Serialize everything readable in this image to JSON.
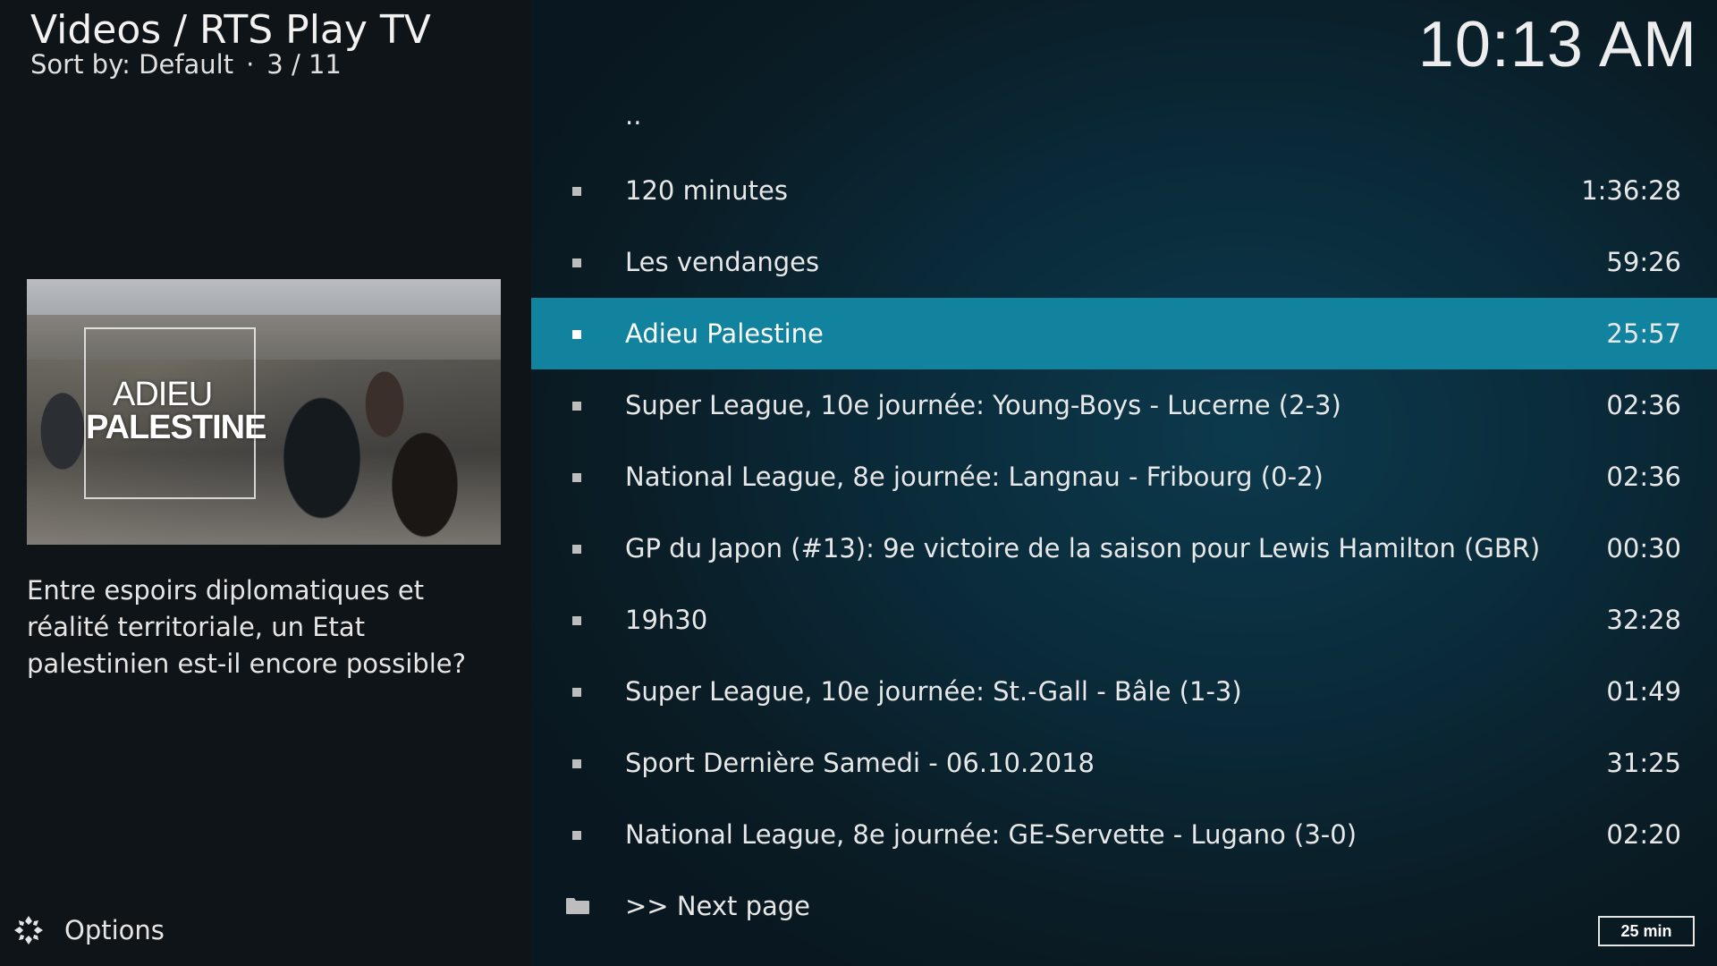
{
  "header": {
    "title": "Videos / RTS Play TV",
    "sort_label": "Sort by: Default",
    "separator": "·",
    "position": "3 / 11"
  },
  "clock": "10:13 AM",
  "selected_item": {
    "thumbnail_text_line1": "ADIEU",
    "thumbnail_text_line2": "PALESTINE",
    "plot": "Entre espoirs diplomatiques et réalité territoriale, un Etat palestinien est-il encore possible?"
  },
  "options": {
    "label": "Options",
    "icon": "options-gear-icon"
  },
  "list": {
    "parent": "..",
    "items": [
      {
        "title": "120 minutes",
        "duration": "1:36:28",
        "selected": false
      },
      {
        "title": "Les vendanges",
        "duration": "59:26",
        "selected": false
      },
      {
        "title": "Adieu Palestine",
        "duration": "25:57",
        "selected": true
      },
      {
        "title": "Super League, 10e journée: Young-Boys - Lucerne (2-3)",
        "duration": "02:36",
        "selected": false
      },
      {
        "title": "National League, 8e journée: Langnau - Fribourg (0-2)",
        "duration": "02:36",
        "selected": false
      },
      {
        "title": "GP du Japon (#13): 9e victoire de la saison pour Lewis Hamilton (GBR)",
        "duration": "00:30",
        "selected": false
      },
      {
        "title": "19h30",
        "duration": "32:28",
        "selected": false
      },
      {
        "title": "Super League, 10e journée: St.-Gall - Bâle (1-3)",
        "duration": "01:49",
        "selected": false
      },
      {
        "title": "Sport Dernière Samedi - 06.10.2018",
        "duration": "31:25",
        "selected": false
      },
      {
        "title": "National League, 8e journée: GE-Servette - Lugano (3-0)",
        "duration": "02:20",
        "selected": false
      }
    ],
    "next_page": ">> Next page"
  },
  "duration_badge": "25 min",
  "colors": {
    "selection": "#12839f",
    "left_panel": "#0f1418",
    "right_panel": "#0a2a39"
  }
}
